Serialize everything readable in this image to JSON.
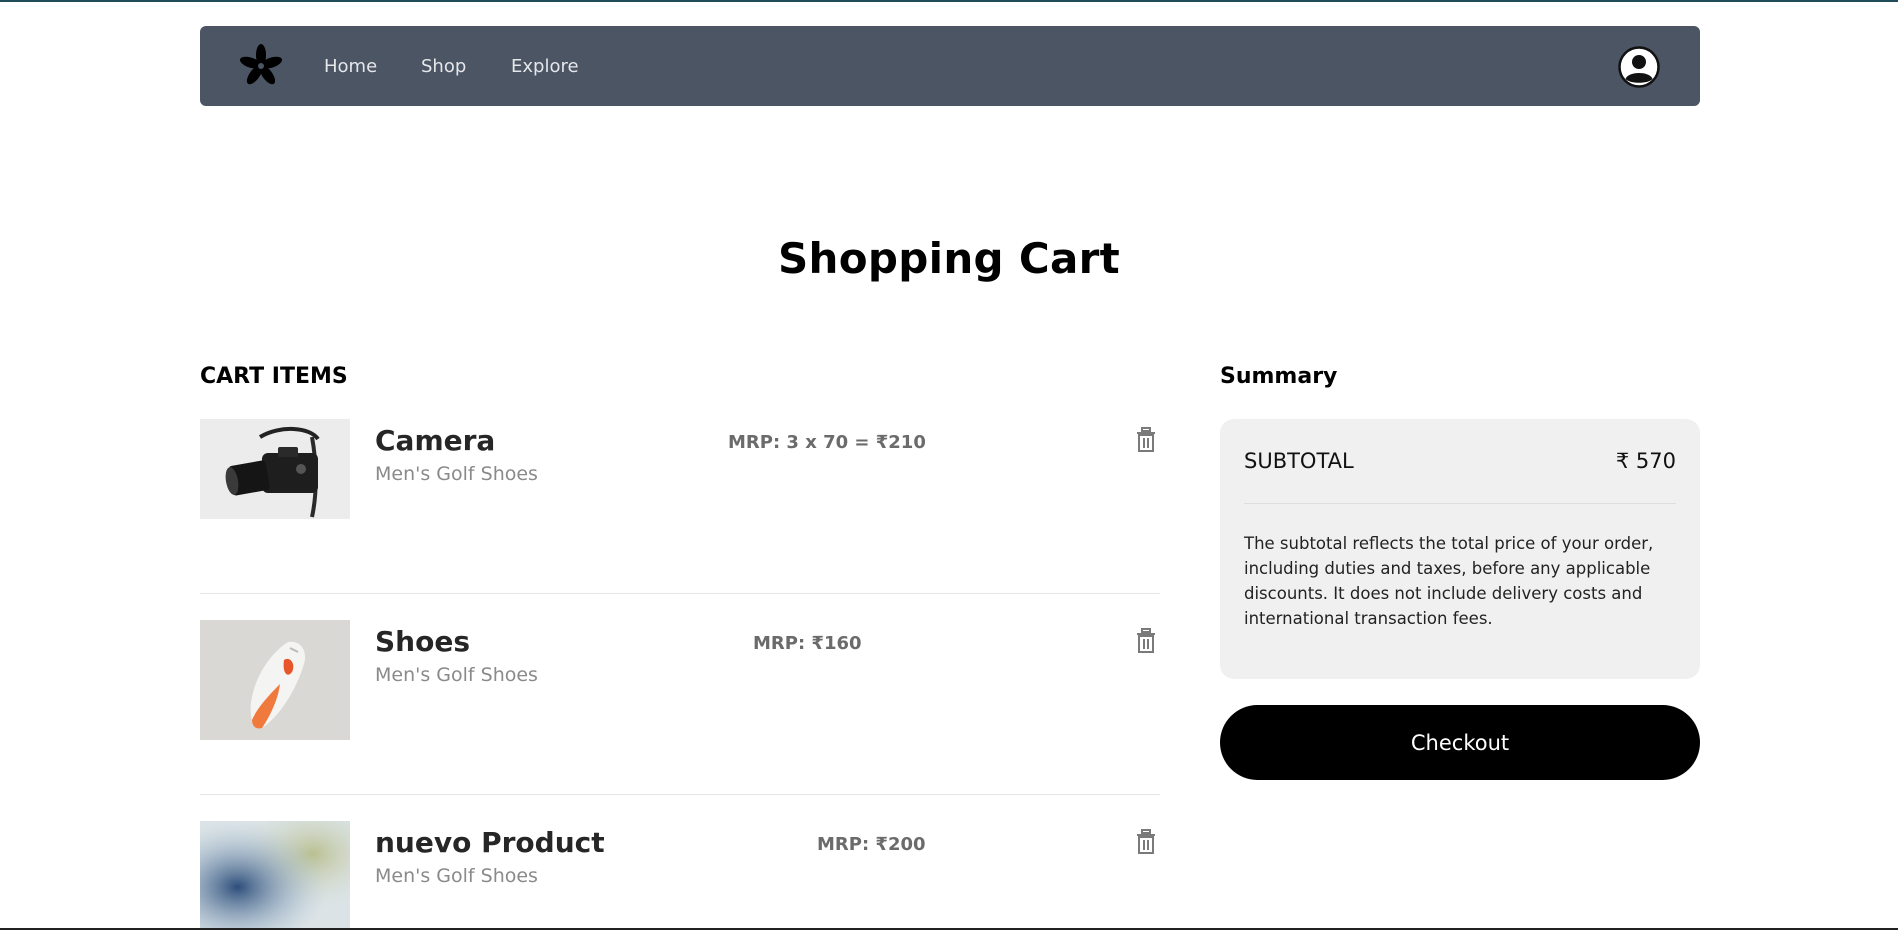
{
  "navbar": {
    "logo_icon": "flower-logo-icon",
    "links": [
      "Home",
      "Shop",
      "Explore"
    ],
    "profile_icon": "user-circle-icon",
    "background": "#4b5563"
  },
  "page": {
    "title": "Shopping Cart"
  },
  "cart": {
    "heading": "CART ITEMS",
    "items": [
      {
        "name": "Camera",
        "description": "Men's Golf Shoes",
        "price": "MRP: 3 x 70 = ₹210",
        "image": "camera-thumbnail",
        "remove_icon": "trash-icon"
      },
      {
        "name": "Shoes",
        "description": "Men's Golf Shoes",
        "price": "MRP: ₹160",
        "image": "shoe-thumbnail",
        "remove_icon": "trash-icon"
      },
      {
        "name": "nuevo Product",
        "description": "Men's Golf Shoes",
        "price": "MRP: ₹200",
        "image": "blurred-product-thumbnail",
        "remove_icon": "trash-icon"
      }
    ]
  },
  "summary": {
    "heading": "Summary",
    "subtotal_label": "SUBTOTAL",
    "subtotal_value": "₹ 570",
    "note": "The subtotal reflects the total price of your order, including duties and taxes, before any applicable discounts. It does not include delivery costs and international transaction fees.",
    "checkout_label": "Checkout"
  }
}
